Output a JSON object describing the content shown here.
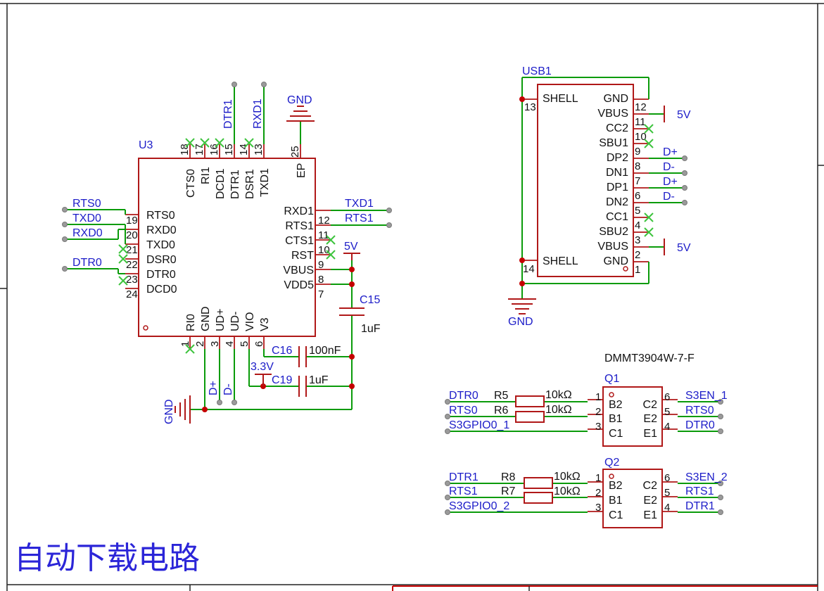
{
  "title_text": "自动下载电路",
  "u3": {
    "designator": "U3",
    "left_pins": [
      {
        "name": "RTS0",
        "num": "19"
      },
      {
        "name": "RXD0",
        "num": "20"
      },
      {
        "name": "TXD0",
        "num": "21"
      },
      {
        "name": "DSR0",
        "num": "22"
      },
      {
        "name": "DTR0",
        "num": "23"
      },
      {
        "name": "DCD0",
        "num": "24"
      }
    ],
    "right_pins": [
      {
        "name": "RXD1",
        "num": "12"
      },
      {
        "name": "RTS1",
        "num": "11"
      },
      {
        "name": "CTS1",
        "num": "10"
      },
      {
        "name": "RST",
        "num": "9"
      },
      {
        "name": "VBUS",
        "num": "8"
      },
      {
        "name": "VDD5",
        "num": "7"
      }
    ],
    "top_pins": [
      {
        "name": "CTS0",
        "num": "18"
      },
      {
        "name": "RI1",
        "num": "17"
      },
      {
        "name": "DCD1",
        "num": "16"
      },
      {
        "name": "DTR1",
        "num": "15"
      },
      {
        "name": "DSR1",
        "num": "14"
      },
      {
        "name": "TXD1",
        "num": "13"
      },
      {
        "name": "EP",
        "num": "25"
      }
    ],
    "bottom_pins": [
      {
        "name": "RI0",
        "num": "1"
      },
      {
        "name": "GND",
        "num": "2"
      },
      {
        "name": "UD+",
        "num": "3"
      },
      {
        "name": "UD-",
        "num": "4"
      },
      {
        "name": "VIO",
        "num": "5"
      },
      {
        "name": "V3",
        "num": "6"
      }
    ]
  },
  "u3_nets": {
    "left": [
      "RTS0",
      "TXD0",
      "RXD0",
      "DTR0"
    ],
    "right": [
      "TXD1",
      "RTS1"
    ],
    "top": [
      "DTR1",
      "RXD1"
    ],
    "top_gnd": "GND",
    "bottom_dp": "D+",
    "bottom_dm": "D-",
    "bottom_gnd": "GND",
    "five_v": "5V",
    "three_v3": "3.3V"
  },
  "caps": {
    "c15": {
      "ref": "C15",
      "value": "1uF"
    },
    "c16": {
      "ref": "C16",
      "value": "100nF"
    },
    "c19": {
      "ref": "C19",
      "value": "1uF"
    }
  },
  "usb1": {
    "designator": "USB1",
    "left_pins": [
      {
        "name": "SHELL",
        "num": "13"
      },
      {
        "name": "SHELL",
        "num": "14"
      }
    ],
    "right_pins": [
      {
        "name": "GND",
        "num": "12"
      },
      {
        "name": "VBUS",
        "num": "11"
      },
      {
        "name": "CC2",
        "num": "10"
      },
      {
        "name": "SBU1",
        "num": "9"
      },
      {
        "name": "DP2",
        "num": "8"
      },
      {
        "name": "DN1",
        "num": "7"
      },
      {
        "name": "DP1",
        "num": "6"
      },
      {
        "name": "DN2",
        "num": "5"
      },
      {
        "name": "CC1",
        "num": "4"
      },
      {
        "name": "SBU2",
        "num": "3"
      },
      {
        "name": "VBUS",
        "num": "2"
      },
      {
        "name": "GND",
        "num": "1"
      }
    ],
    "nets": {
      "v5a": "5V",
      "dp2": "D+",
      "dn1": "D-",
      "dp1": "D+",
      "dn2": "D-",
      "v5b": "5V",
      "gnd": "GND"
    }
  },
  "q_part": "DMMT3904W-7-F",
  "q1": {
    "designator": "Q1",
    "left_pins": [
      {
        "name": "B2",
        "num": "1"
      },
      {
        "name": "B1",
        "num": "2"
      },
      {
        "name": "C1",
        "num": "3"
      }
    ],
    "right_pins": [
      {
        "name": "C2",
        "num": "6"
      },
      {
        "name": "E2",
        "num": "5"
      },
      {
        "name": "E1",
        "num": "4"
      }
    ],
    "nets_left": [
      "DTR0",
      "RTS0",
      "S3GPIO0_1"
    ],
    "nets_right": [
      "S3EN_1",
      "RTS0",
      "DTR0"
    ],
    "r_a": {
      "ref": "R5",
      "value": "10kΩ"
    },
    "r_b": {
      "ref": "R6",
      "value": "10kΩ"
    }
  },
  "q2": {
    "designator": "Q2",
    "left_pins": [
      {
        "name": "B2",
        "num": "1"
      },
      {
        "name": "B1",
        "num": "2"
      },
      {
        "name": "C1",
        "num": "3"
      }
    ],
    "right_pins": [
      {
        "name": "C2",
        "num": "6"
      },
      {
        "name": "E2",
        "num": "5"
      },
      {
        "name": "E1",
        "num": "4"
      }
    ],
    "nets_left": [
      "DTR1",
      "RTS1",
      "S3GPIO0_2"
    ],
    "nets_right": [
      "S3EN_2",
      "RTS1",
      "DTR1"
    ],
    "r_a": {
      "ref": "R8",
      "value": "10kΩ"
    },
    "r_b": {
      "ref": "R7",
      "value": "10kΩ"
    }
  },
  "colors": {
    "wire": "#0a9b0a",
    "body": "#b01818",
    "net_label": "#1c1cc8",
    "junction": "#c40000",
    "title": "#2b25d8"
  }
}
